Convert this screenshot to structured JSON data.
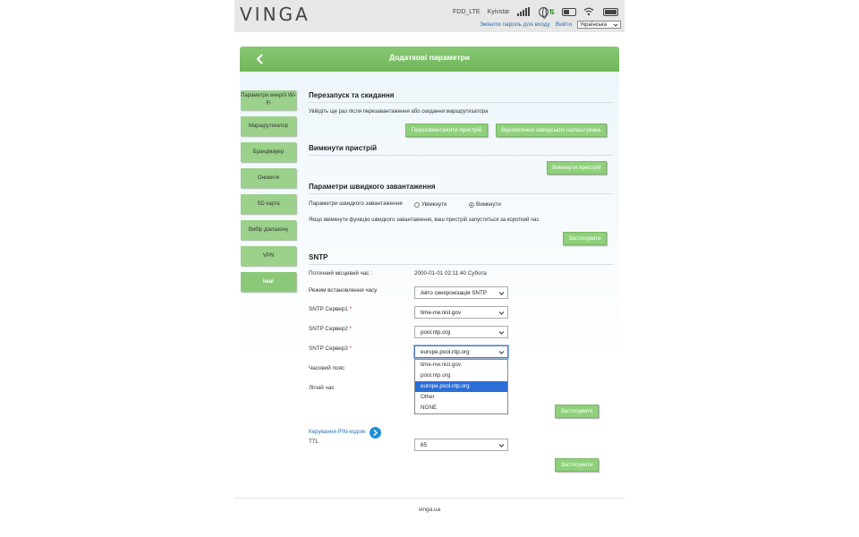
{
  "header": {
    "logo": "VINGA",
    "network_mode": "FDD_LTE",
    "operator": "Kyivstar",
    "change_password_link": "Змінити пароль для входу",
    "logout_link": "Вийти",
    "language_selected": "Українська"
  },
  "title_bar": {
    "title": "Додаткові параметри"
  },
  "sidebar": {
    "items": [
      {
        "label": "Параметри енергії Wi-Fi"
      },
      {
        "label": "Маршрутизатор"
      },
      {
        "label": "Брандмауер"
      },
      {
        "label": "Оновити"
      },
      {
        "label": "SD карта"
      },
      {
        "label": "Вибір діапазону"
      },
      {
        "label": "VPN"
      },
      {
        "label": "Інші"
      }
    ]
  },
  "restart_section": {
    "title": "Перезапуск та скидання",
    "description": "Увійдіть ще раз після перезавантаження або скидання маршрутизатора",
    "restart_button": "Перезавантажити пристрій",
    "factory_reset_button": "Відновлення заводських налаштувань"
  },
  "shutdown_section": {
    "title": "Вимкнути пристрій",
    "shutdown_button": "Вимкнути пристрій"
  },
  "fastboot_section": {
    "title": "Параметри швидкого завантаження",
    "label": "Параметри швидкого завантаження",
    "option_on": "Увімкнути",
    "option_off": "Вимкнути",
    "note": "Якщо ввімкнути функцію швидкого завантаження, ваш пристрій запуститься за короткий час",
    "apply_button": "Застосувати"
  },
  "sntp_section": {
    "title": "SNTP",
    "local_time_label": "Поточний місцевий час :",
    "local_time_value": "2000-01-01 02:11:40   Субота",
    "time_mode_label": "Режим встановлення часу",
    "time_mode_value": "Авто синхронізація SNTP",
    "server1_label": "SNTP Сервер1",
    "server1_value": "time-nw.nist.gov",
    "server2_label": "SNTP Сервер2",
    "server2_value": "pool.ntp.org",
    "server3_label": "SNTP Сервер3",
    "server3_value": "europe.pool.ntp.org",
    "timezone_label": "Часовий пояс",
    "dst_label": "Літній час",
    "required_mark": "*",
    "dropdown_options": [
      "time-nw.nist.gov",
      "pool.ntp.org",
      "europe.pool.ntp.org",
      "Other",
      "NONE"
    ],
    "apply_button": "Застосувати"
  },
  "pin_section": {
    "pin_link": "Керування PIN-кодом",
    "ttl_label": "TTL",
    "ttl_value": "65",
    "apply_button": "Застосувати"
  },
  "footer": {
    "text": "vinga.ua"
  },
  "colors": {
    "green": "#8fd07b",
    "green_dark": "#6fb65a",
    "link_blue": "#2a6fb5",
    "selected_option": "#2b6fd6"
  }
}
